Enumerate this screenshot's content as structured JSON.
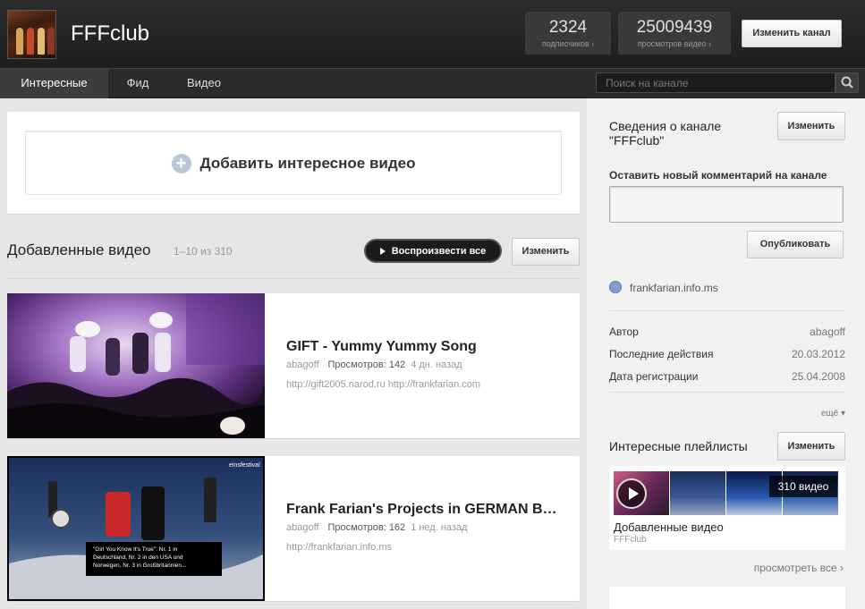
{
  "header": {
    "channel_name": "FFFclub",
    "subscribers": {
      "count": "2324",
      "label": "подписчиков ›"
    },
    "views": {
      "count": "25009439",
      "label": "просмотров видео ›"
    },
    "edit_channel_label": "Изменить канал"
  },
  "nav": {
    "tabs": [
      {
        "label": "Интересные",
        "active": true
      },
      {
        "label": "Фид",
        "active": false
      },
      {
        "label": "Видео",
        "active": false
      }
    ],
    "search_placeholder": "Поиск на канале"
  },
  "main": {
    "add_video_label": "Добавить интересное видео",
    "section_title": "Добавленные видео",
    "section_count": "1–10 из 310",
    "play_all_label": "Воспроизвести все",
    "edit_label": "Изменить",
    "videos": [
      {
        "title": "GIFT - Yummy Yummy Song",
        "author": "abagoff",
        "views_label": "Просмотров: 142",
        "age": "4 дн. назад",
        "description": "http://gift2005.narod.ru http://frankfarian.com"
      },
      {
        "title": "Frank Farian's Projects in GERMAN B…",
        "author": "abagoff",
        "views_label": "Просмотров: 162",
        "age": "1 нед. назад",
        "description": "http://frankfarian.info.ms",
        "overlay_logo": "einsfestival",
        "overlay_text": "\"Girl You Know It's True\": Nr. 1 in Deutschland, Nr. 2 in den USA und Norwegen, Nr. 3 in Großbritannien..."
      }
    ]
  },
  "sidebar": {
    "about_title": "Сведения о канале \"FFFclub\"",
    "edit_label": "Изменить",
    "comment_label": "Оставить новый комментарий на канале",
    "publish_label": "Опубликовать",
    "website": "frankfarian.info.ms",
    "rows": [
      {
        "label": "Автор",
        "value": "abagoff"
      },
      {
        "label": "Последние действия",
        "value": "20.03.2012"
      },
      {
        "label": "Дата регистрации",
        "value": "25.04.2008"
      }
    ],
    "more_label": "ещё ▾",
    "playlists_title": "Интересные плейлисты",
    "playlist": {
      "count_label": "310 видео",
      "name": "Добавленные видео",
      "owner": "FFFclub"
    },
    "view_all_label": "просмотреть все ›"
  }
}
